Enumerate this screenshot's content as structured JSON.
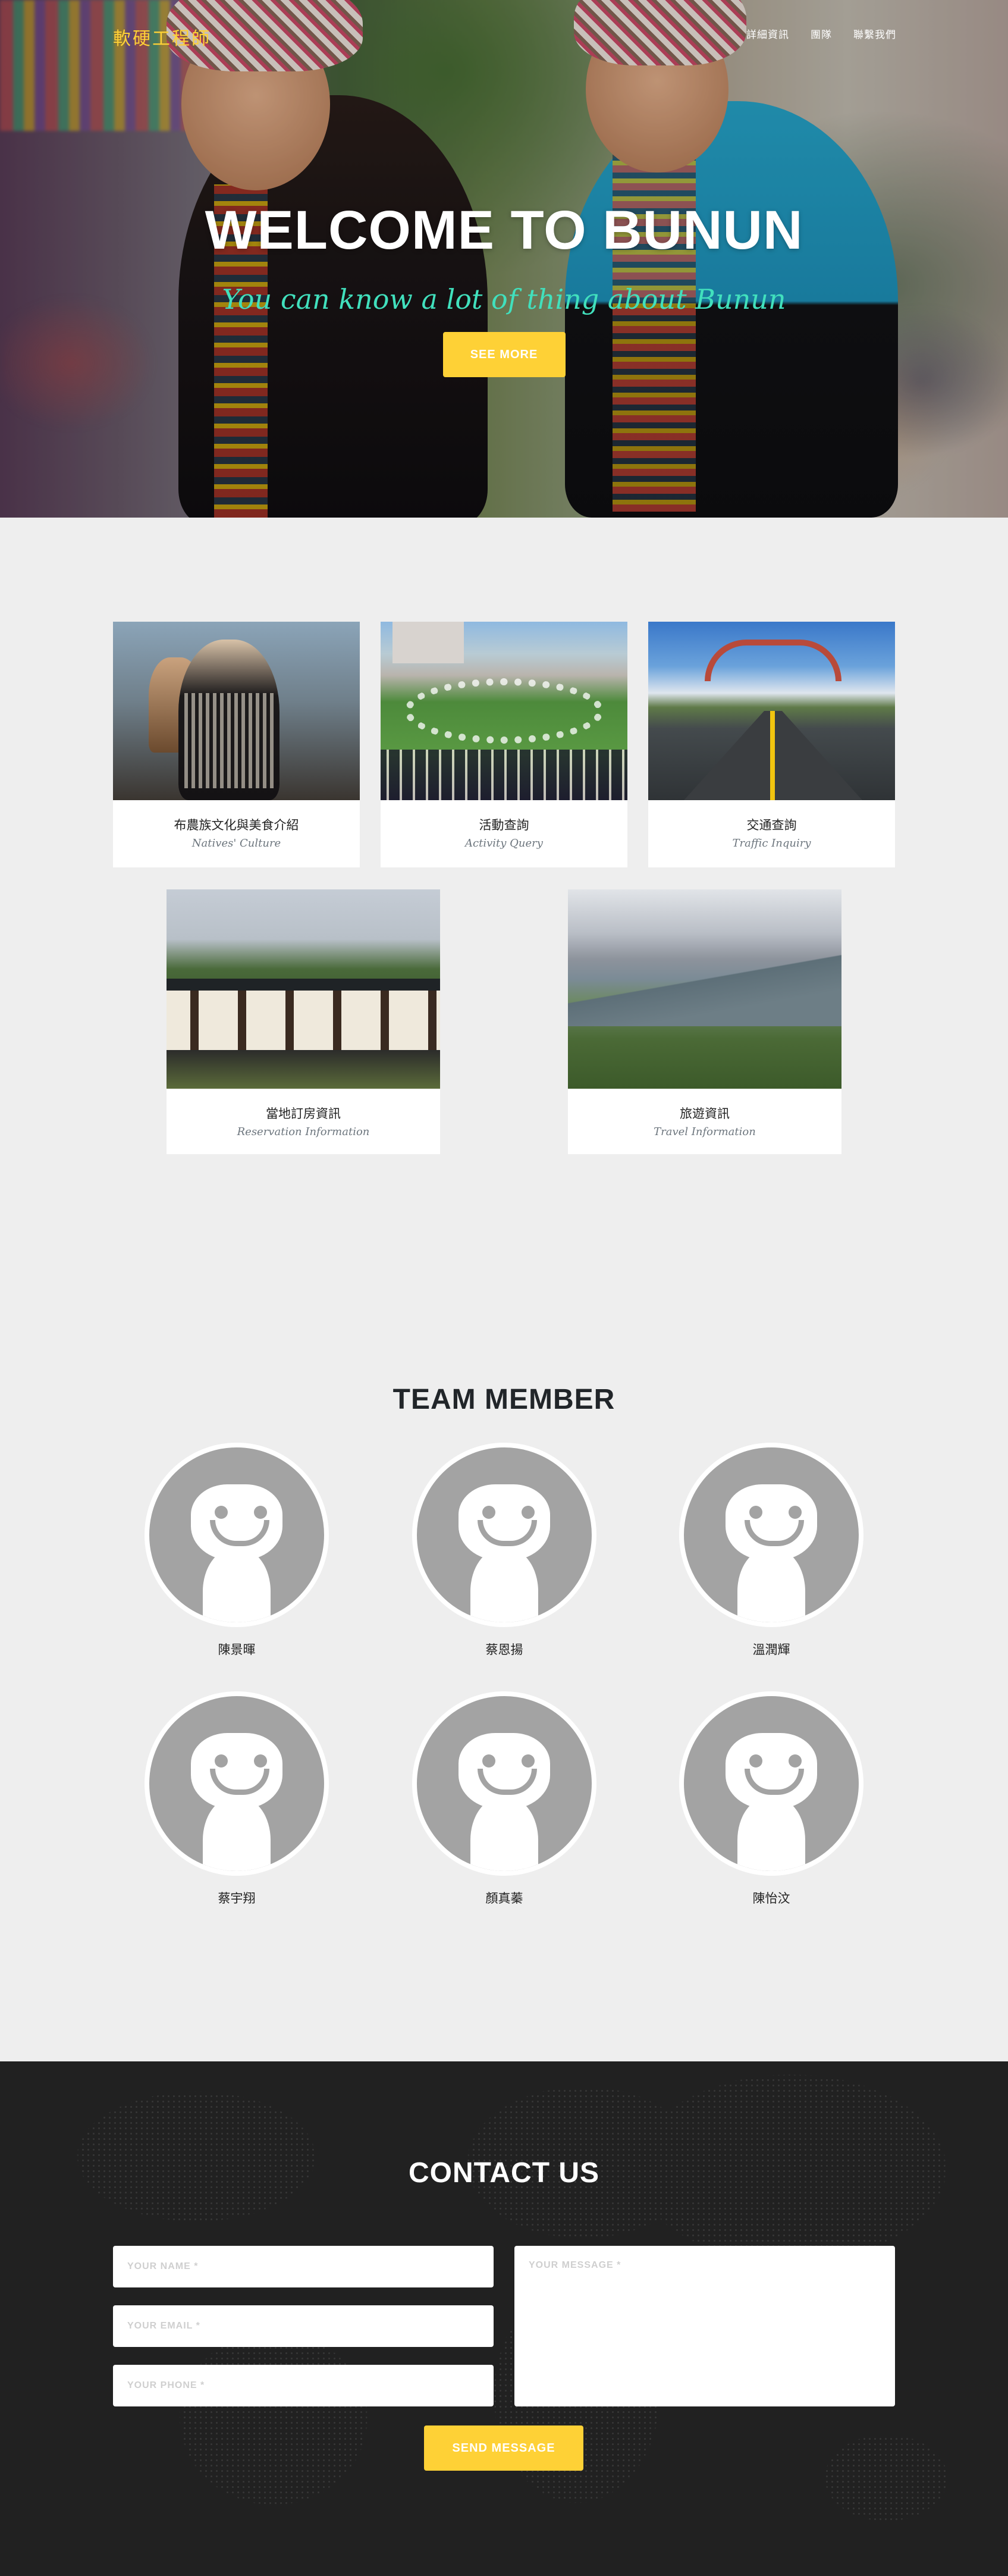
{
  "nav": {
    "brand": "軟硬工程師",
    "links": [
      "詳細資訊",
      "團隊",
      "聯繫我們"
    ]
  },
  "hero": {
    "title": "WELCOME TO BUNUN",
    "subtitle": "You can know a lot of thing about Bunun",
    "button": "SEE MORE"
  },
  "services": {
    "items": [
      {
        "title": "布農族文化與美食介紹",
        "subtitle": "Natives' Culture"
      },
      {
        "title": "活動查詢",
        "subtitle": "Activity Query"
      },
      {
        "title": "交通查詢",
        "subtitle": "Traffic Inquiry"
      },
      {
        "title": "當地訂房資訊",
        "subtitle": "Reservation Information"
      },
      {
        "title": "旅遊資訊",
        "subtitle": "Travel Information"
      }
    ]
  },
  "team": {
    "heading": "TEAM MEMBER",
    "members": [
      "陳景暉",
      "蔡恩揚",
      "溫潤輝",
      "蔡宇翔",
      "顏真蓁",
      "陳怡汶"
    ]
  },
  "contact": {
    "heading": "CONTACT US",
    "name_placeholder": "YOUR NAME *",
    "email_placeholder": "YOUR EMAIL *",
    "phone_placeholder": "YOUR PHONE *",
    "message_placeholder": "YOUR MESSAGE *",
    "send_label": "SEND MESSAGE"
  },
  "colors": {
    "accent": "#fed136",
    "subtitle": "#41e0bd",
    "contact_bg": "#212121",
    "page_bg": "#eeeeee"
  }
}
